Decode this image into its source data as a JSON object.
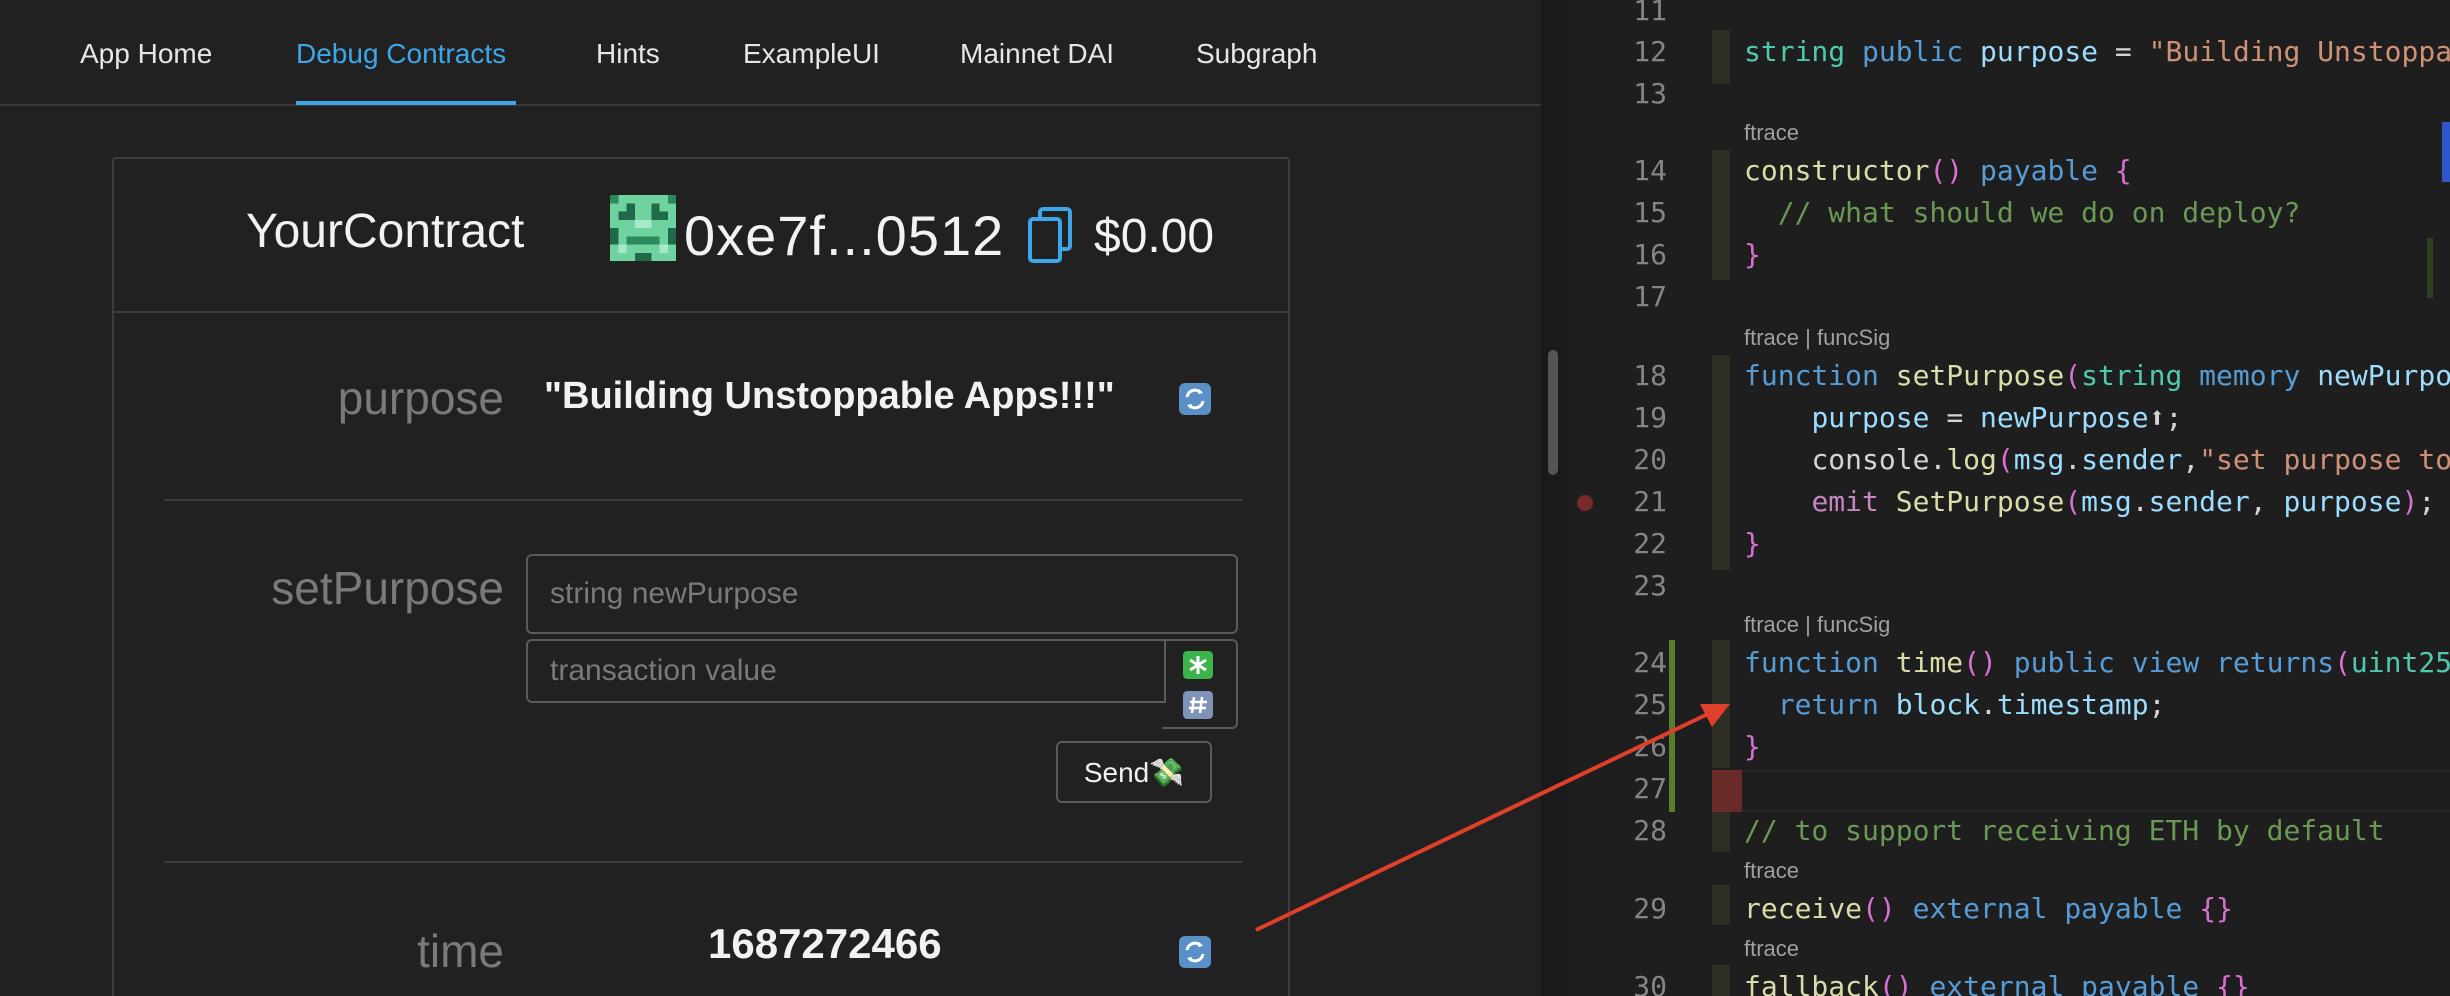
{
  "nav": {
    "items": [
      {
        "label": "App Home",
        "active": false
      },
      {
        "label": "Debug Contracts",
        "active": true
      },
      {
        "label": "Hints",
        "active": false
      },
      {
        "label": "ExampleUI",
        "active": false
      },
      {
        "label": "Mainnet DAI",
        "active": false
      },
      {
        "label": "Subgraph",
        "active": false
      }
    ]
  },
  "contract": {
    "name": "YourContract",
    "address": "0xe7f...0512",
    "balance": "$0.00",
    "blockie_icon": "identicon-icon",
    "copy_icon": "copy-icon"
  },
  "fields": {
    "purpose": {
      "label": "purpose",
      "value": "\"Building Unstoppable Apps!!!\"",
      "icon": "refresh-icon"
    },
    "setPurpose": {
      "label": "setPurpose",
      "param_placeholder": "string newPurpose",
      "value_placeholder": "transaction value",
      "send_label": "Send💸",
      "ether_icon": "asterisk-icon",
      "hash_icon": "hash-icon"
    },
    "time": {
      "label": "time",
      "value": "1687272466",
      "icon": "refresh-icon"
    }
  },
  "editor": {
    "line_numbers": [
      "11",
      "12",
      "13",
      "14",
      "15",
      "16",
      "17",
      "18",
      "19",
      "20",
      "21",
      "22",
      "23",
      "24",
      "25",
      "26",
      "27",
      "28",
      "29",
      "30"
    ],
    "lens": {
      "l14": "ftrace",
      "l18": "ftrace | funcSig",
      "l24": "ftrace | funcSig",
      "l29": "ftrace",
      "l30": "ftrace"
    },
    "code": {
      "l12": "string public purpose = \"Building Unstoppa",
      "l14": "constructor() payable {",
      "l15": "  // what should we do on deploy?",
      "l16": "}",
      "l18": "function setPurpose(string memory newPurpo",
      "l19": "    purpose = newPurpose⬆;",
      "l20": "    console.log(msg.sender,\"set purpose to",
      "l21": "    emit SetPurpose(msg.sender, purpose);",
      "l22": "}",
      "l24": "function time() public view returns(uint25",
      "l25": "  return block.timestamp;",
      "l26": "}",
      "l28": "// to support receiving ETH by default",
      "l29": "receive() external payable {}",
      "l30": "fallback() external payable {}"
    }
  },
  "colors": {
    "accent": "#3ea6e8",
    "arrow": "#e0402a",
    "background": "#212121"
  }
}
